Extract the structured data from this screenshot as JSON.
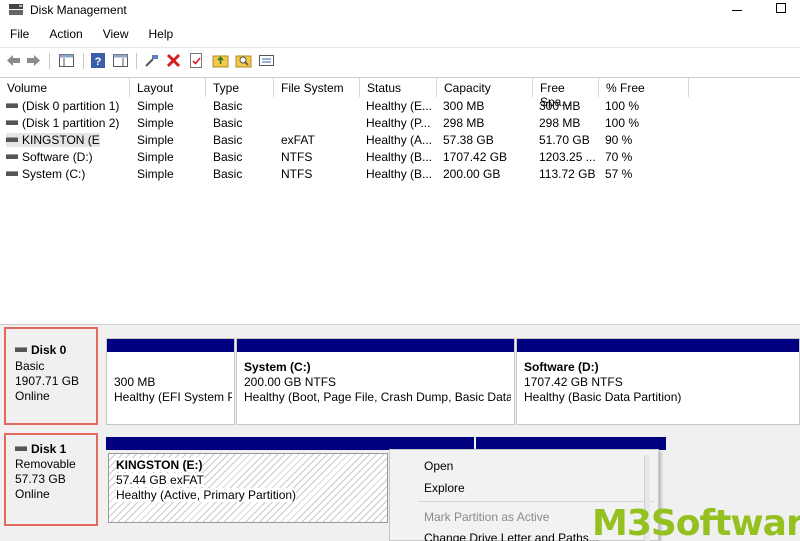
{
  "window": {
    "title": "Disk Management"
  },
  "menu": [
    "File",
    "Action",
    "View",
    "Help"
  ],
  "toolbar": {
    "buttons": [
      "back-icon",
      "forward-icon",
      "properties-pane-icon",
      "help-icon",
      "console-pane-icon",
      "connect-icon",
      "delete-icon",
      "check-icon",
      "up-folder-icon",
      "search-icon",
      "list-icon"
    ]
  },
  "columns": [
    "Volume",
    "Layout",
    "Type",
    "File System",
    "Status",
    "Capacity",
    "Free Spa...",
    "% Free"
  ],
  "rows": [
    {
      "volume": "(Disk 0 partition 1)",
      "layout": "Simple",
      "type": "Basic",
      "fs": "",
      "status": "Healthy (E...",
      "capacity": "300 MB",
      "free": "300 MB",
      "pct": "100 %"
    },
    {
      "volume": "(Disk 1 partition 2)",
      "layout": "Simple",
      "type": "Basic",
      "fs": "",
      "status": "Healthy (P...",
      "capacity": "298 MB",
      "free": "298 MB",
      "pct": "100 %"
    },
    {
      "volume": "KINGSTON (E:)",
      "layout": "Simple",
      "type": "Basic",
      "fs": "exFAT",
      "status": "Healthy (A...",
      "capacity": "57.38 GB",
      "free": "51.70 GB",
      "pct": "90 %"
    },
    {
      "volume": "Software (D:)",
      "layout": "Simple",
      "type": "Basic",
      "fs": "NTFS",
      "status": "Healthy (B...",
      "capacity": "1707.42 GB",
      "free": "1203.25 ...",
      "pct": "70 %"
    },
    {
      "volume": "System (C:)",
      "layout": "Simple",
      "type": "Basic",
      "fs": "NTFS",
      "status": "Healthy (B...",
      "capacity": "200.00 GB",
      "free": "113.72 GB",
      "pct": "57 %"
    }
  ],
  "disk0": {
    "name": "Disk 0",
    "type": "Basic",
    "size": "1907.71 GB",
    "state": "Online",
    "partitions": [
      {
        "title": "",
        "size": "300 MB",
        "status": "Healthy (EFI System P"
      },
      {
        "title": "System  (C:)",
        "size": "200.00 GB NTFS",
        "status": "Healthy (Boot, Page File, Crash Dump, Basic Data F"
      },
      {
        "title": "Software  (D:)",
        "size": "1707.42 GB NTFS",
        "status": "Healthy (Basic Data Partition)"
      }
    ]
  },
  "disk1": {
    "name": "Disk 1",
    "type": "Removable",
    "size": "57.73 GB",
    "state": "Online",
    "partitions": [
      {
        "title": "KINGSTON  (E:)",
        "size": "57.44 GB exFAT",
        "status": "Healthy (Active, Primary Partition)"
      }
    ]
  },
  "context_menu": {
    "open": "Open",
    "explore": "Explore",
    "mark_active": "Mark Partition as Active",
    "change_letter": "Change Drive Letter and Paths..."
  },
  "watermark": {
    "m3": "M3",
    "software": "Software"
  },
  "colors": {
    "partition_bar": "#000080",
    "highlight_border": "#e06a5e",
    "watermark": "#94c11f"
  }
}
